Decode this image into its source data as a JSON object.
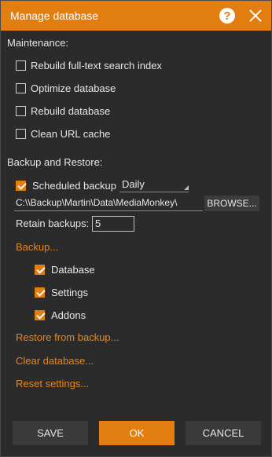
{
  "window": {
    "title": "Manage database"
  },
  "maintenance": {
    "label": "Maintenance:",
    "items": [
      {
        "label": "Rebuild full-text search index",
        "checked": false
      },
      {
        "label": "Optimize database",
        "checked": false
      },
      {
        "label": "Rebuild database",
        "checked": false
      },
      {
        "label": "Clean URL cache",
        "checked": false
      }
    ]
  },
  "backup": {
    "label": "Backup and Restore:",
    "scheduled_label": "Scheduled backup",
    "scheduled_checked": true,
    "frequency": "Daily",
    "path": "C:\\\\Backup\\Martin\\Data\\MediaMonkey\\",
    "browse_label": "BROWSE...",
    "retain_label": "Retain backups:",
    "retain_value": "5",
    "backup_link": "Backup...",
    "backup_items": [
      {
        "label": "Database",
        "checked": true
      },
      {
        "label": "Settings",
        "checked": true
      },
      {
        "label": "Addons",
        "checked": true
      }
    ],
    "restore_link": "Restore from backup...",
    "clear_link": "Clear database...",
    "reset_link": "Reset settings..."
  },
  "buttons": {
    "save": "SAVE",
    "ok": "OK",
    "cancel": "CANCEL"
  },
  "colors": {
    "accent": "#e27d10",
    "background": "#2b2b2b"
  }
}
